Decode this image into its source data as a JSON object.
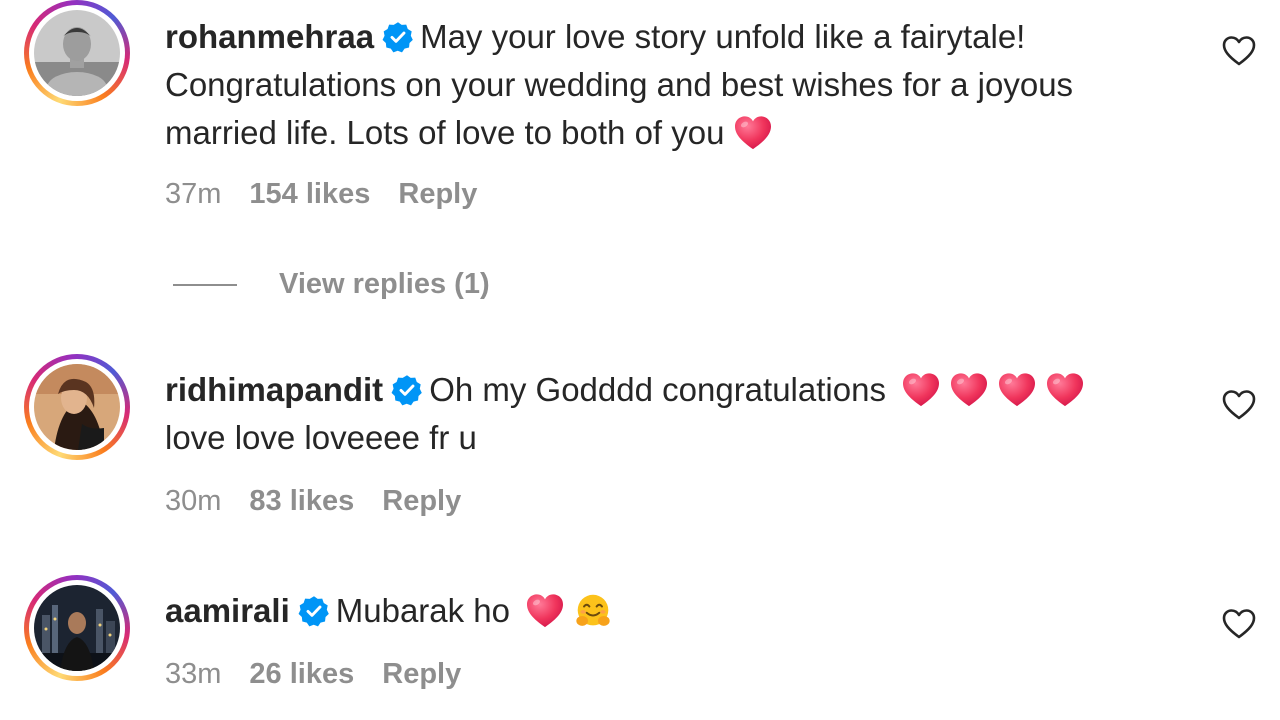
{
  "comments": [
    {
      "username": "rohanmehraa",
      "verified": true,
      "text_line1": "May your love story unfold like a fairytale!",
      "text_line2": "Congratulations on your wedding and best wishes for a joyous",
      "text_line3": "married life. Lots of love to both of you",
      "time": "37m",
      "likes": "154 likes",
      "reply": "Reply",
      "view_replies": "View replies (1)"
    },
    {
      "username": "ridhimapandit",
      "verified": true,
      "text_line1": "Oh my Godddd congratulations",
      "text_line2": "love love loveeee fr u",
      "time": "30m",
      "likes": "83 likes",
      "reply": "Reply"
    },
    {
      "username": "aamirali",
      "verified": true,
      "text_line1": "Mubarak ho",
      "time": "33m",
      "likes": "26 likes",
      "reply": "Reply"
    }
  ],
  "colors": {
    "verified": "#0095f6",
    "heart_emoji": "#f0355c",
    "meta_text": "#8e8e8e",
    "text": "#262626"
  },
  "icons": [
    "verified-badge-icon",
    "heart-emoji-icon",
    "hugging-face-emoji-icon",
    "like-heart-outline-icon"
  ]
}
